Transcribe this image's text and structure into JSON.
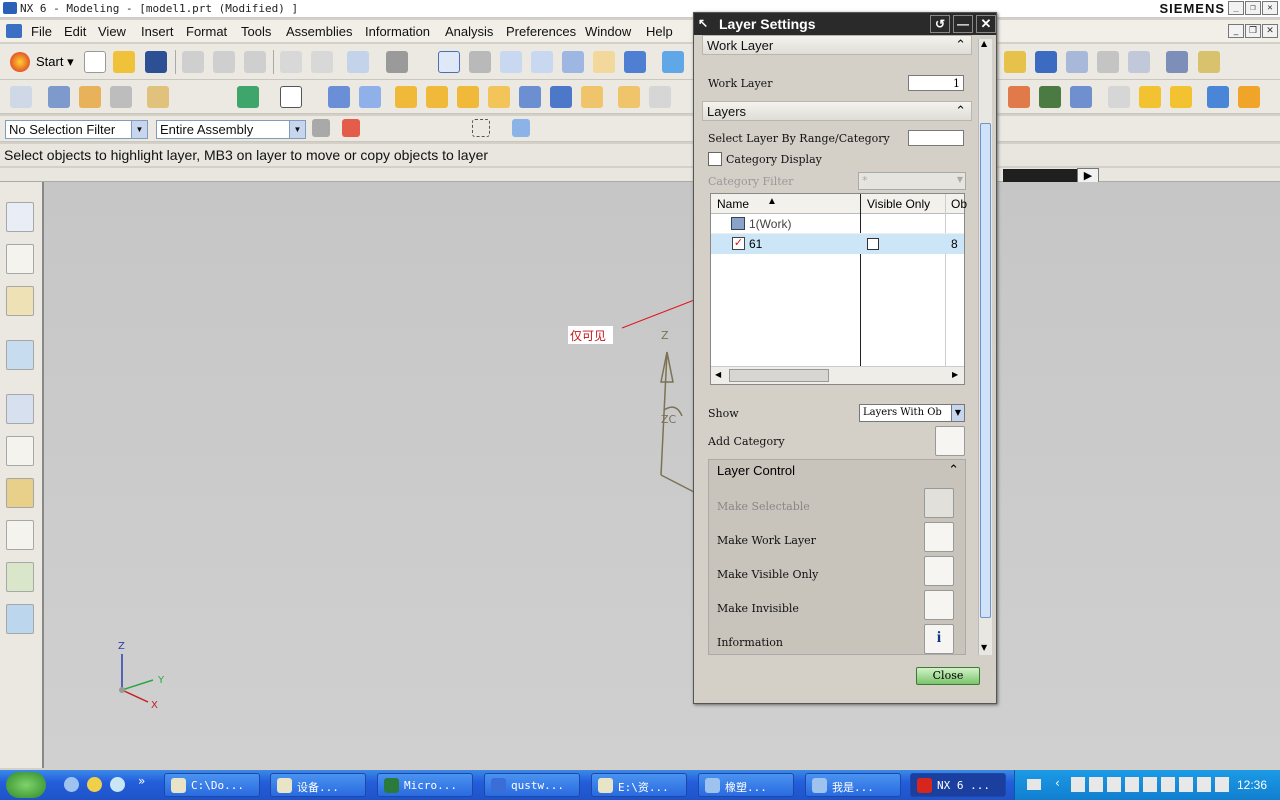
{
  "window": {
    "title": "NX 6 - Modeling - [model1.prt (Modified) ]",
    "brand": "SIEMENS"
  },
  "menu": [
    "File",
    "Edit",
    "View",
    "Insert",
    "Format",
    "Tools",
    "Assemblies",
    "Information",
    "Analysis",
    "Preferences",
    "Window",
    "Help"
  ],
  "toolbar": {
    "start_label": "Start"
  },
  "selection_bar": {
    "filter": "No Selection Filter",
    "scope": "Entire Assembly"
  },
  "cue_line": "Select objects to highlight layer, MB3 on layer to move or copy objects to layer",
  "annotation": {
    "text": "仅可见"
  },
  "triad_labels": {
    "z": "Z",
    "zc": "ZC",
    "small_z": "Z",
    "small_y": "Y",
    "small_x": "X"
  },
  "dialog": {
    "title": "Layer Settings",
    "work_layer_section": "Work Layer",
    "work_layer_label": "Work Layer",
    "work_layer_value": "1",
    "layers_section": "Layers",
    "select_by_label": "Select Layer By Range/Category",
    "select_by_value": "",
    "category_display_label": "Category Display",
    "category_filter_label": "Category Filter",
    "category_filter_value": "*",
    "columns": [
      "Name",
      "Visible Only",
      "Ob"
    ],
    "rows": [
      {
        "name": "1(Work)",
        "count": ""
      },
      {
        "name": "61",
        "count": "8"
      }
    ],
    "show_label": "Show",
    "show_value": "Layers With Ob",
    "add_category_label": "Add Category",
    "layer_control_section": "Layer Control",
    "controls": [
      "Make Selectable",
      "Make Work Layer",
      "Make Visible Only",
      "Make Invisible",
      "Information"
    ],
    "close_label": "Close"
  },
  "taskbar": {
    "tasks": [
      "C:\\Do...",
      "设备...",
      "Micro...",
      "qustw...",
      "E:\\资...",
      "橡塑...",
      "我是...",
      "NX 6 ..."
    ],
    "clock": "12:36"
  },
  "colors": {
    "annotation_line": "#e0141e",
    "selected_row": "#cde6f7",
    "taskbar": "#245edb"
  }
}
